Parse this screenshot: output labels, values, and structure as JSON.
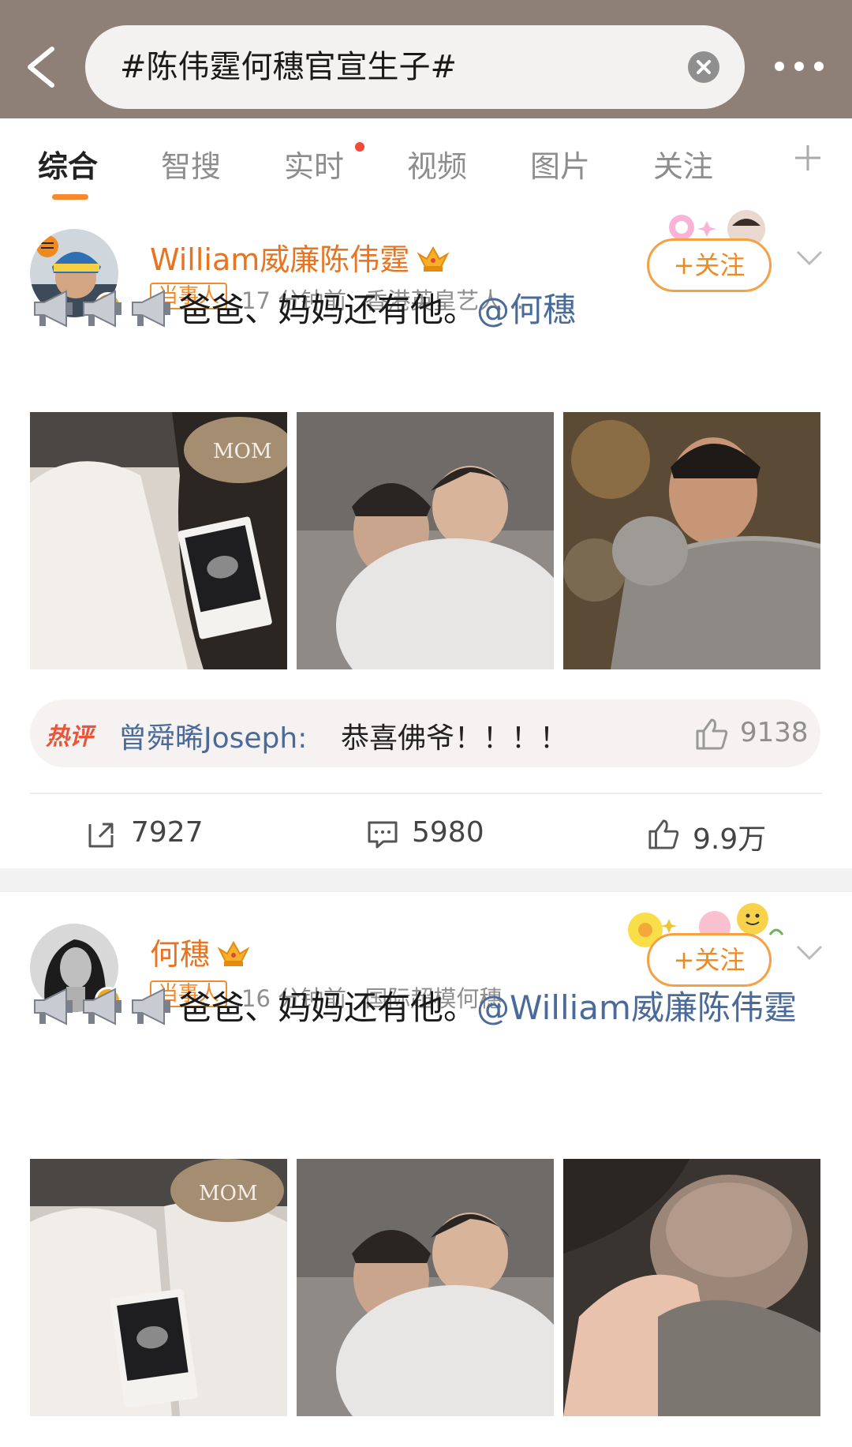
{
  "search": {
    "query": "#陈伟霆何穗官宣生子#"
  },
  "tabs": [
    {
      "label": "综合"
    },
    {
      "label": "智搜"
    },
    {
      "label": "实时"
    },
    {
      "label": "视频"
    },
    {
      "label": "图片"
    },
    {
      "label": "关注"
    }
  ],
  "posts": [
    {
      "user": "William威廉陈伟霆",
      "role": "当事人",
      "time": "17 分钟前",
      "source": "香港英皇艺人...",
      "follow": "+关注",
      "text": "爸爸、妈妈还有他。",
      "mention": "@何穗",
      "hot_comment": {
        "tag": "热评",
        "user": "曾舜晞Joseph:",
        "text": "恭喜佛爷！！！！",
        "likes": "9138"
      },
      "reposts": "7927",
      "comments": "5980",
      "likes": "9.9万"
    },
    {
      "user": "何穗",
      "role": "当事人",
      "time": "16 分钟前",
      "source": "国际超模何穗",
      "follow": "+关注",
      "text": "爸爸、妈妈还有他。",
      "mention": "@William威廉陈伟霆"
    }
  ],
  "colors": {
    "accent": "#f08a1e",
    "link": "#4a6a9a",
    "header": "#8e8076"
  },
  "icons": [
    "back-arrow-icon",
    "clear-icon",
    "more-icon",
    "plus-icon",
    "crown-icon",
    "verified-icon",
    "megaphone-icon",
    "chevron-down-icon",
    "thumb-up-icon",
    "repost-icon",
    "comment-icon"
  ]
}
